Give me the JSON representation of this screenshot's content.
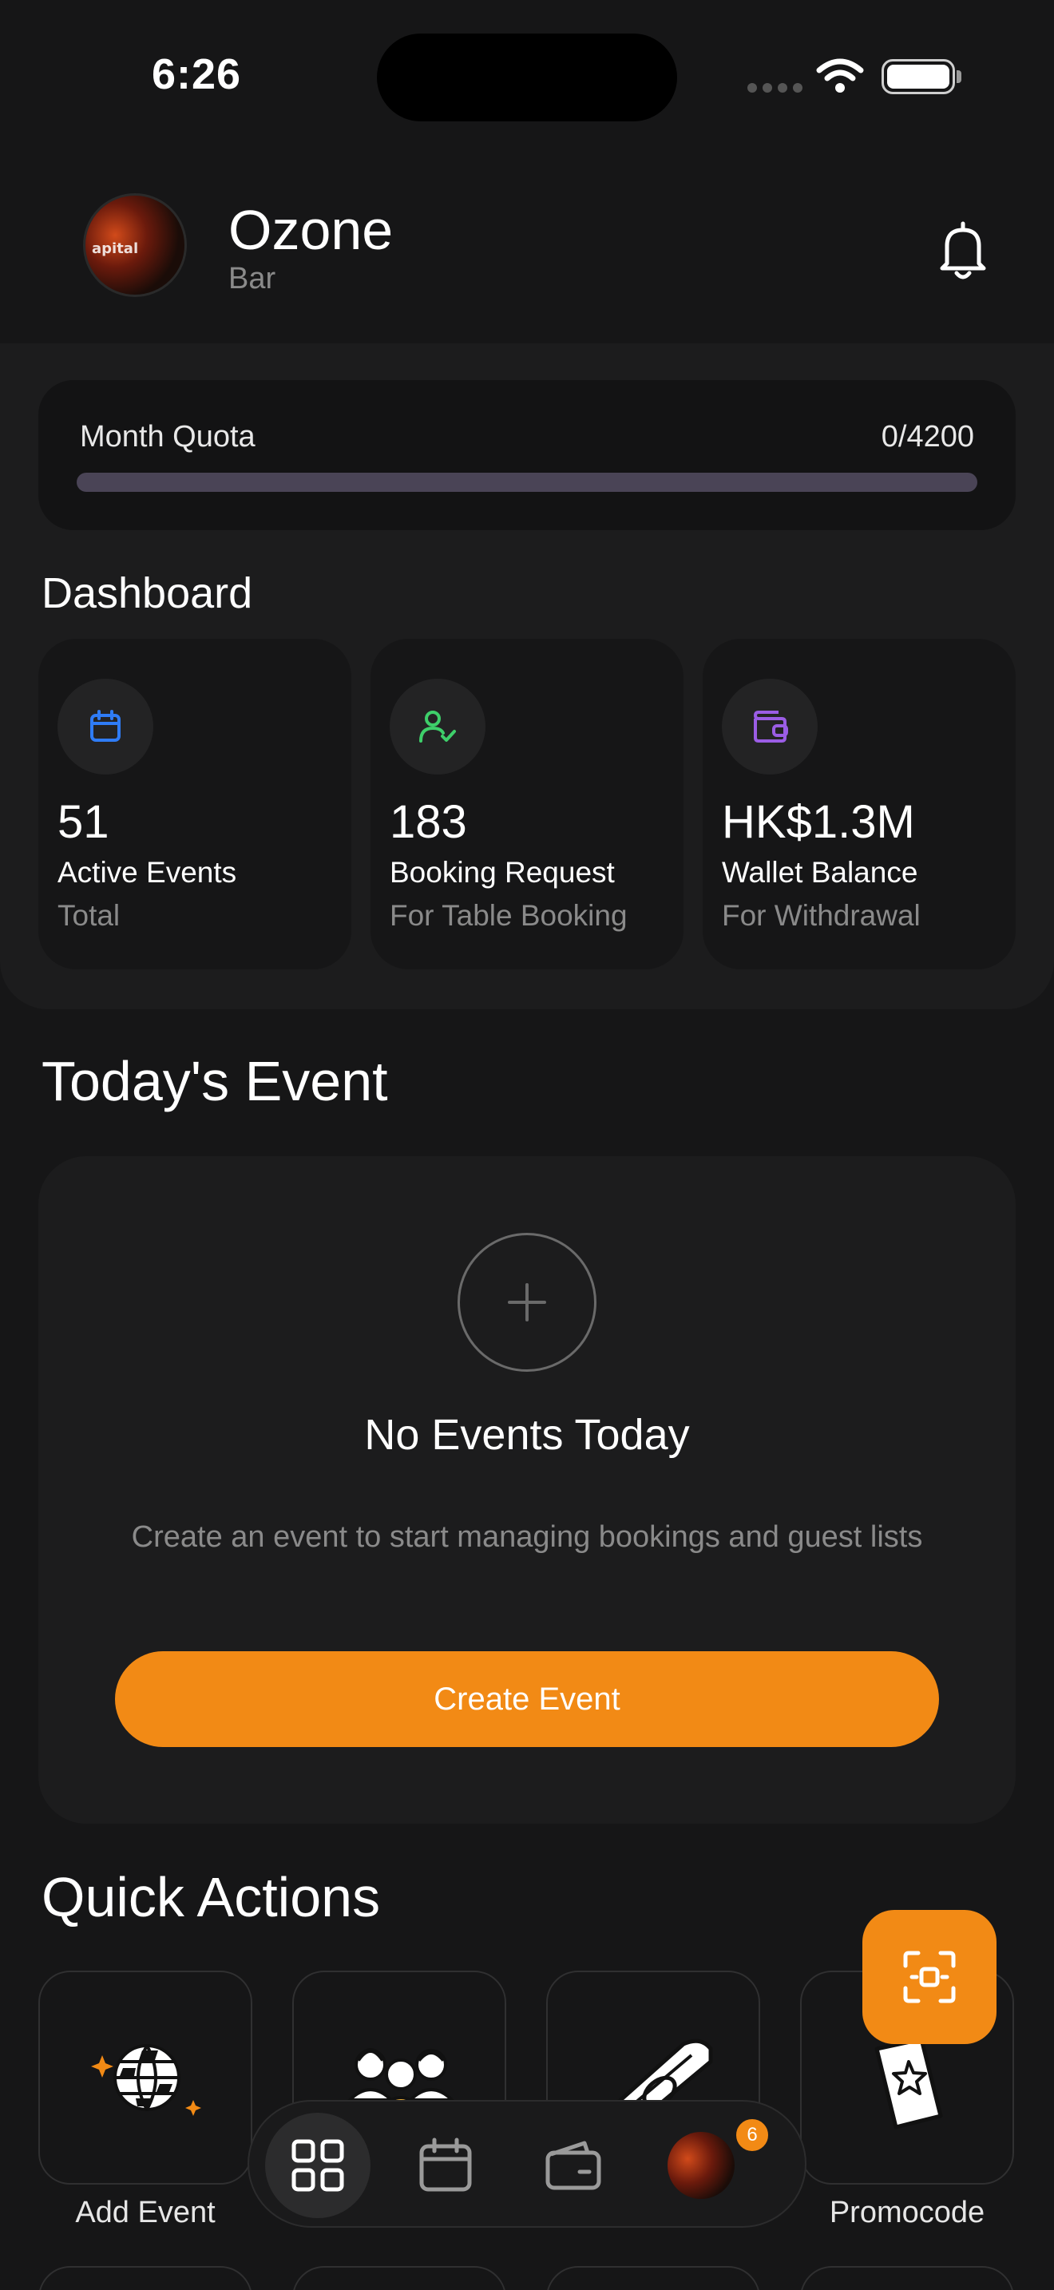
{
  "status_bar": {
    "time": "6:26"
  },
  "header": {
    "venue_name": "Ozone",
    "venue_type": "Bar",
    "avatar_text": "apital"
  },
  "quota": {
    "label": "Month Quota",
    "value_text": "0/4200",
    "used": 0,
    "total": 4200
  },
  "dashboard": {
    "title": "Dashboard",
    "cards": [
      {
        "value": "51",
        "label": "Active Events",
        "sub": "Total",
        "icon": "calendar-icon",
        "color": "#2f7cf6"
      },
      {
        "value": "183",
        "label": "Booking Request",
        "sub": "For Table Booking",
        "icon": "user-check-icon",
        "color": "#3ecf6a"
      },
      {
        "value": "HK$1.3M",
        "label": "Wallet Balance",
        "sub": "For Withdrawal",
        "icon": "wallet-icon",
        "color": "#9b5de5"
      }
    ]
  },
  "today": {
    "title": "Today's Event",
    "empty_title": "No Events Today",
    "empty_desc": "Create an event to start managing bookings and guest lists",
    "button": "Create Event"
  },
  "quick_actions": {
    "title": "Quick Actions",
    "items": [
      {
        "label": "Add Event",
        "icon": "globe-icon"
      },
      {
        "label": "",
        "icon": "people-icon"
      },
      {
        "label": "",
        "icon": "money-icon"
      },
      {
        "label": "Promocode",
        "icon": "ticket-star-icon"
      }
    ]
  },
  "tab_bar": {
    "items": [
      {
        "icon": "grid-icon",
        "active": true
      },
      {
        "icon": "calendar-icon",
        "active": false
      },
      {
        "icon": "wallet-icon",
        "active": false
      },
      {
        "icon": "profile-avatar",
        "active": false,
        "badge": "6"
      }
    ]
  },
  "colors": {
    "accent": "#f28a15",
    "background": "#161617",
    "card": "#1c1c1d"
  }
}
